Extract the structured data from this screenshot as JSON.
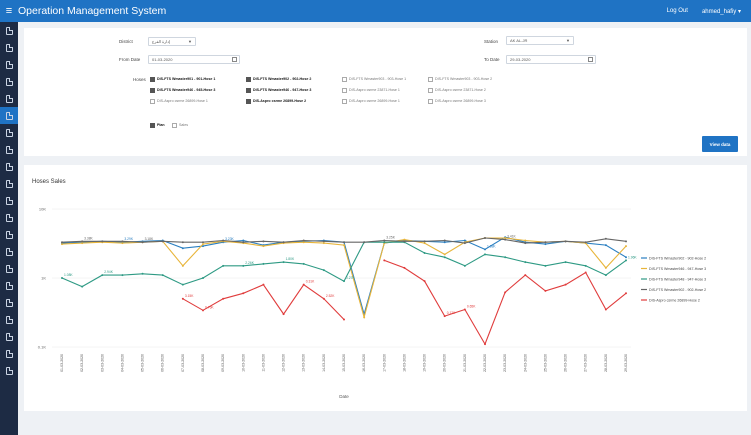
{
  "app": {
    "title": "Operation Management System",
    "logout": "Log Out",
    "user": "ahmed_hafiy ▾"
  },
  "sidebar": {
    "count": 21,
    "active_index": 5,
    "icon": "document-icon"
  },
  "filters": {
    "district_label": "District",
    "district_value": "إدارة الفرع",
    "station_label": "Station",
    "station_value": "AK AL-JR",
    "from_label": "From Date",
    "from_value": "01-03-2020",
    "to_label": "To Date",
    "to_value": "29-03-2020",
    "hoses_label": "Hoses",
    "hoses": [
      {
        "label": "DIS-FTS Wmaster901 - 901-Hose 1",
        "checked": true
      },
      {
        "label": "DIS-FTS Wmaster902 - 902-Hose 2",
        "checked": true
      },
      {
        "label": "DIS-FTS Wmaster903 - 903-Hose 1",
        "checked": false
      },
      {
        "label": "DIS-FTS Wmaster903 - 903-Hose 2",
        "checked": false
      },
      {
        "label": "DIS-FTS Wmaster946 - 945-Hose 3",
        "checked": true
      },
      {
        "label": "DIS-FTS Wmaster946 - 947-Hose 3",
        "checked": true
      },
      {
        "label": "DIS-Aspro csrme 23871-Hose 1",
        "checked": false
      },
      {
        "label": "DIS-Aspro csrme 23871-Hose 2",
        "checked": false
      },
      {
        "label": "DIS-Aspro csrme 26899-Hose 1",
        "checked": false
      },
      {
        "label": "DIS-Aspro csrme 26899-Hose 2",
        "checked": true
      },
      {
        "label": "DIS-Aspro csrme 26899-Hose 1",
        "checked": false
      },
      {
        "label": "DIS-Aspro csrme 26899-Hose 3",
        "checked": false
      }
    ],
    "option1": "Plan",
    "option2": "Sales",
    "view_button": "View data"
  },
  "chart_data": {
    "type": "line",
    "title": "Hoses Sales",
    "xlabel": "Date",
    "ylabel": "",
    "y_scale": "log",
    "ylim": [
      100,
      10000
    ],
    "y_ticks": [
      "10K",
      "1K",
      "0.1K"
    ],
    "x": [
      "01-03-2020",
      "02-03-2020",
      "03-03-2020",
      "04-03-2020",
      "05-03-2020",
      "06-03-2020",
      "07-03-2020",
      "08-03-2020",
      "09-03-2020",
      "10-03-2020",
      "11-03-2020",
      "12-03-2020",
      "13-03-2020",
      "14-03-2020",
      "15-03-2020",
      "16-03-2020",
      "17-03-2020",
      "18-03-2020",
      "19-03-2020",
      "20-03-2020",
      "21-03-2020",
      "22-03-2020",
      "23-03-2020",
      "24-03-2020",
      "25-03-2020",
      "26-03-2020",
      "27-03-2020",
      "28-03-2020",
      "29-03-2020"
    ],
    "legend_position": "right",
    "series": [
      {
        "name": "DIS-FTS Wmaster902 - 902-Hose 2",
        "color": "#2a7fc1",
        "values": [
          3200,
          3300,
          3400,
          3300,
          3400,
          3500,
          2700,
          2900,
          3300,
          3500,
          3000,
          3300,
          3400,
          3500,
          3300,
          300,
          3200,
          3500,
          3400,
          3300,
          3500,
          2600,
          3900,
          3300,
          3100,
          3400,
          3200,
          3000,
          2000
        ]
      },
      {
        "name": "DIS-FTS Wmaster946 - 947-Hose 3",
        "color": "#e8b53a",
        "values": [
          3100,
          3200,
          3300,
          3200,
          3300,
          3400,
          1500,
          3100,
          3400,
          3200,
          2900,
          3200,
          3300,
          3200,
          3000,
          270,
          3200,
          3600,
          3200,
          2200,
          3300,
          3800,
          3800,
          3500,
          3300,
          3400,
          3200,
          1400,
          2900
        ]
      },
      {
        "name": "DIS-FTS Wmaster948 - 947-Hose 3",
        "color": "#2e9a84",
        "values": [
          1000,
          750,
          1100,
          1100,
          1150,
          1100,
          800,
          1000,
          1500,
          1500,
          1600,
          1700,
          1600,
          1300,
          900,
          3300,
          3300,
          3300,
          2300,
          2000,
          1500,
          2200,
          2000,
          1700,
          1500,
          1700,
          1500,
          1100,
          1800
        ]
      },
      {
        "name": "DIS-FTS Wmaster902 - 902-Hose 2",
        "color": "#666666",
        "values": [
          3300,
          3400,
          3400,
          3400,
          3300,
          3400,
          3300,
          3300,
          3500,
          3300,
          3400,
          3300,
          3500,
          3400,
          3300,
          3300,
          3500,
          3400,
          3400,
          3500,
          3200,
          3800,
          3600,
          3200,
          3300,
          3400,
          3300,
          3700,
          3400
        ]
      },
      {
        "name": "DIS-Aspro csrme 26899-Hose 2",
        "color": "#e03c3c",
        "values": [
          null,
          null,
          null,
          null,
          null,
          null,
          500,
          340,
          500,
          600,
          800,
          300,
          800,
          500,
          250,
          null,
          1800,
          1400,
          900,
          280,
          350,
          110,
          620,
          1100,
          650,
          800,
          1200,
          350,
          600
        ]
      }
    ],
    "data_labels": [
      "1.08K",
      "0.76K",
      "2.94K",
      "3.18K",
      "3.23K",
      "3.15K",
      "2.26K",
      "2.52K",
      "0.27K",
      "0.12K",
      "1.58K",
      "0.65K",
      "1.80K",
      "0.31K",
      "3.38K",
      "3.29K",
      "3.25K",
      "3.41K",
      "1.96K"
    ]
  }
}
